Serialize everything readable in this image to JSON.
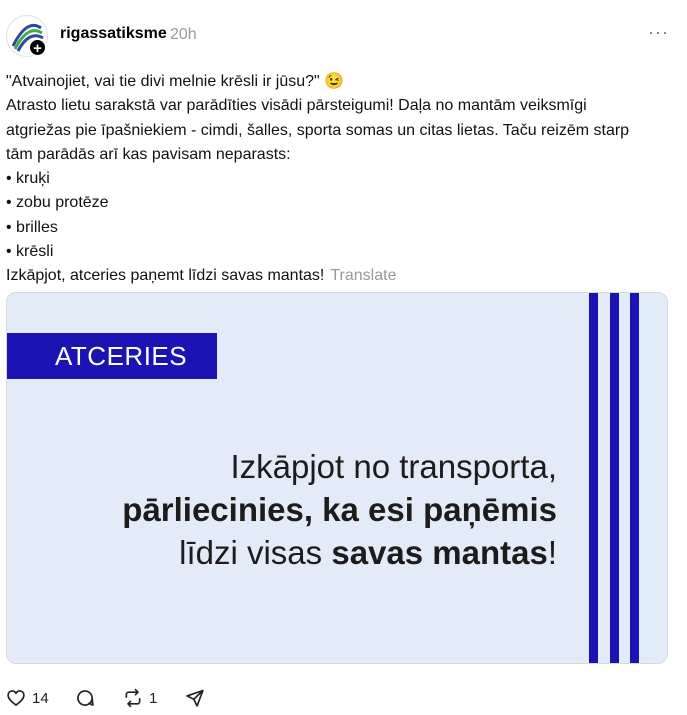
{
  "post": {
    "username": "rigassatiksme",
    "timestamp": "20h",
    "more_label": "···",
    "lines": [
      "\"Atvainojiet, vai tie divi melnie krēsli ir jūsu?\" 😉",
      "Atrasto lietu sarakstā var parādīties visādi pārsteigumi! Daļa no mantām veiksmīgi",
      "atgriežas pie īpašniekiem - cimdi, šalles, sporta somas un citas lietas. Taču reizēm starp",
      "tām parādās arī kas pavisam neparasts:",
      "• kruķi",
      "• zobu protēze",
      "• brilles",
      "• krēsli",
      "Izkāpjot, atceries paņemt līdzi savas mantas!"
    ],
    "translate_label": "Translate"
  },
  "media": {
    "badge_text": "ATCERIES",
    "headline": {
      "line1": "Izkāpjot no transporta,",
      "line2": "pārliecinies, ka esi paņēmis",
      "line3_regular": "līdzi visas ",
      "line3_bold": "savas mantas",
      "line3_end": "!"
    },
    "accent_color": "#1c13b5",
    "background_color": "#e4ebf8"
  },
  "actions": {
    "likes": "14",
    "reposts": "1",
    "icons": [
      "heart-icon",
      "comment-icon",
      "repost-icon",
      "share-icon"
    ]
  }
}
